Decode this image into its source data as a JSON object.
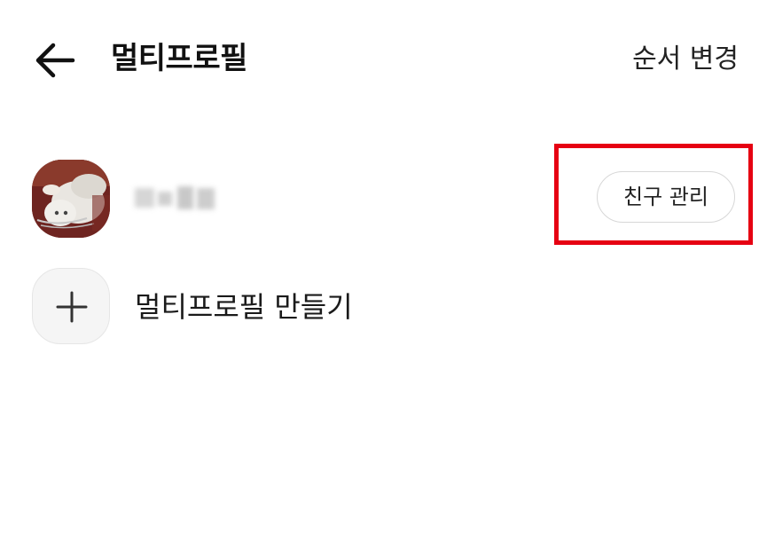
{
  "header": {
    "title": "멀티프로필",
    "back_icon": "arrow-left-icon",
    "reorder_label": "순서 변경"
  },
  "profile": {
    "avatar_icon": "cat-photo-avatar",
    "name": "",
    "manage_friends_label": "친구 관리"
  },
  "create": {
    "icon": "plus-icon",
    "label": "멀티프로필 만들기"
  },
  "colors": {
    "highlight": "#e60012",
    "background": "#ffffff",
    "button_border": "#d7d7d7"
  }
}
